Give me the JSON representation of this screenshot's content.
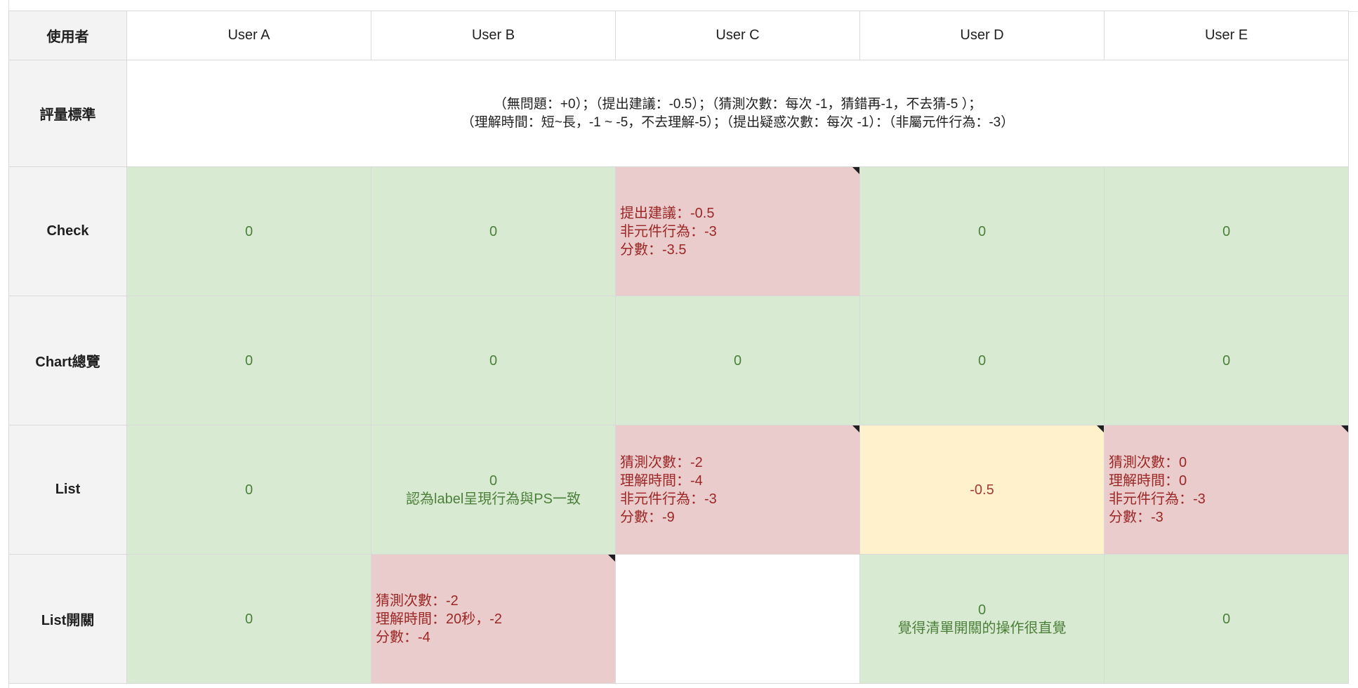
{
  "header": {
    "row_label": "使用者",
    "users": [
      "User A",
      "User B",
      "User C",
      "User D",
      "User E"
    ]
  },
  "criteria": {
    "label": "評量標準",
    "line1": "（無問題：+0）；（提出建議：-0.5）；（猜測次數：每次 -1，猜錯再-1，不去猜-5 ）；",
    "line2": "（理解時間：短~長，-1 ~ -5，不去理解-5）；（提出疑惑次數：每次 -1）：（非屬元件行為：-3）"
  },
  "rows": [
    {
      "label": "Check",
      "cells": [
        {
          "status": "good",
          "lines": [
            "0"
          ]
        },
        {
          "status": "good",
          "lines": [
            "0"
          ]
        },
        {
          "status": "bad",
          "note": true,
          "lines": [
            "提出建議：-0.5",
            "非元件行為：-3",
            "分數：-3.5"
          ]
        },
        {
          "status": "good",
          "lines": [
            "0"
          ]
        },
        {
          "status": "good",
          "lines": [
            "0"
          ]
        }
      ]
    },
    {
      "label": "Chart總覽",
      "cells": [
        {
          "status": "good",
          "lines": [
            "0"
          ]
        },
        {
          "status": "good",
          "lines": [
            "0"
          ]
        },
        {
          "status": "good",
          "lines": [
            "0"
          ]
        },
        {
          "status": "good",
          "lines": [
            "0"
          ]
        },
        {
          "status": "good",
          "lines": [
            "0"
          ]
        }
      ]
    },
    {
      "label": "List",
      "cells": [
        {
          "status": "good",
          "lines": [
            "0"
          ]
        },
        {
          "status": "good",
          "lines": [
            "0",
            "認為label呈現行為與PS一致"
          ]
        },
        {
          "status": "bad",
          "note": true,
          "lines": [
            "猜測次數：-2",
            "理解時間：-4",
            "非元件行為：-3",
            "分數：-9"
          ]
        },
        {
          "status": "warn",
          "note": true,
          "lines": [
            "-0.5"
          ]
        },
        {
          "status": "bad",
          "note": true,
          "lines": [
            "猜測次數：0",
            "理解時間：0",
            "非元件行為：-3",
            "分數：-3"
          ]
        }
      ]
    },
    {
      "label": "List開關",
      "cells": [
        {
          "status": "good",
          "lines": [
            "0"
          ]
        },
        {
          "status": "bad",
          "note": true,
          "lines": [
            "猜測次數：-2",
            "理解時間：20秒，-2",
            "分數：-4"
          ]
        },
        {
          "status": "empty",
          "lines": []
        },
        {
          "status": "good",
          "lines": [
            "0",
            "覺得清單開關的操作很直覺"
          ]
        },
        {
          "status": "good",
          "lines": [
            "0"
          ]
        }
      ]
    }
  ],
  "colors": {
    "good_fill": "#d9ead3",
    "good_text": "#4c7f3a",
    "bad_fill": "#eacccc",
    "bad_text": "#9b2727",
    "warn_fill": "#fff1cc",
    "header_fill": "#f3f3f3",
    "gridline": "#d9d9d9"
  }
}
